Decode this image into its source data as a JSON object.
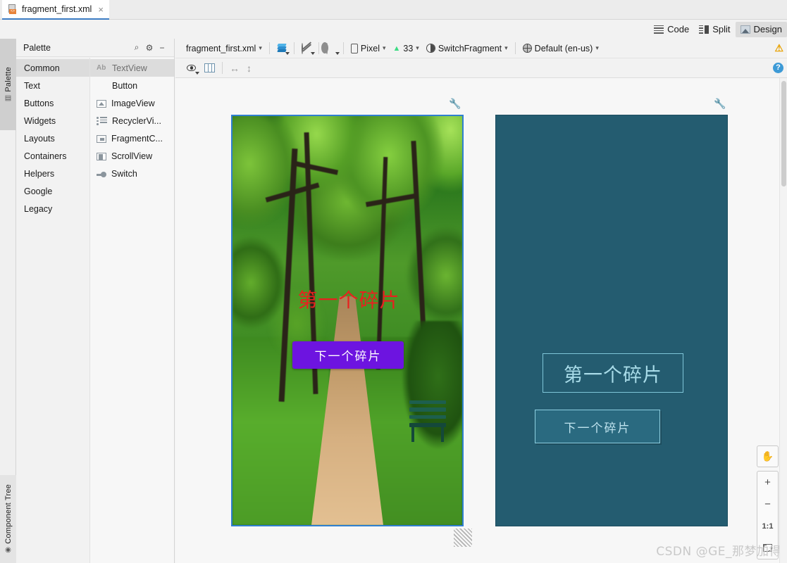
{
  "window": {
    "tab": {
      "title": "fragment_first.xml",
      "close": "×",
      "icon": "xml-layout-file-icon"
    }
  },
  "mode_bar": {
    "items": [
      {
        "label": "Code",
        "icon": "code-lines-icon",
        "active": false
      },
      {
        "label": "Split",
        "icon": "split-view-icon",
        "active": false
      },
      {
        "label": "Design",
        "icon": "design-view-icon",
        "active": true
      }
    ]
  },
  "left_strip": {
    "tabs": [
      {
        "label": "Palette",
        "icon": "palette-icon"
      },
      {
        "label": "Component Tree",
        "icon": "component-tree-icon"
      }
    ]
  },
  "palette": {
    "title": "Palette",
    "actions": [
      {
        "name": "search-icon",
        "glyph": "⌕"
      },
      {
        "name": "gear-icon",
        "glyph": "⚙"
      },
      {
        "name": "minimize-icon",
        "glyph": "−"
      }
    ],
    "categories": [
      {
        "label": "Common",
        "selected": true
      },
      {
        "label": "Text",
        "selected": false
      },
      {
        "label": "Buttons",
        "selected": false
      },
      {
        "label": "Widgets",
        "selected": false
      },
      {
        "label": "Layouts",
        "selected": false
      },
      {
        "label": "Containers",
        "selected": false
      },
      {
        "label": "Helpers",
        "selected": false
      },
      {
        "label": "Google",
        "selected": false
      },
      {
        "label": "Legacy",
        "selected": false
      }
    ],
    "items": [
      {
        "label": "TextView",
        "icon": "textview-icon",
        "selected": true
      },
      {
        "label": "Button",
        "icon": "button-icon",
        "selected": false
      },
      {
        "label": "ImageView",
        "icon": "imageview-icon",
        "selected": false
      },
      {
        "label": "RecyclerVi...",
        "icon": "recyclerview-icon",
        "selected": false
      },
      {
        "label": "FragmentC...",
        "icon": "fragmentcontainer-icon",
        "selected": false
      },
      {
        "label": "ScrollView",
        "icon": "scrollview-icon",
        "selected": false
      },
      {
        "label": "Switch",
        "icon": "switch-icon",
        "selected": false
      }
    ]
  },
  "toolbar": {
    "file_label": "fragment_first.xml",
    "design_mode_icon": "layers-icon",
    "blueprint_toggle_icon": "no-constraints-icon",
    "theme_render_icon": "render-mode-icon",
    "device_label": "Pixel",
    "device_icon": "phone-icon",
    "api_label": "33",
    "api_icon": "android-icon",
    "theme_label": "SwitchFragment",
    "theme_icon": "theme-icon",
    "locale_label": "Default (en-us)",
    "locale_icon": "globe-icon",
    "warning_icon": "warning-icon",
    "warning_glyph": "⚠"
  },
  "view_toolbar": {
    "eye_icon": "visibility-icon",
    "columns_icon": "layout-columns-icon",
    "align_h_icon": "horizontal-arrow-icon",
    "align_h_glyph": "↔",
    "align_v_icon": "vertical-arrow-icon",
    "align_v_glyph": "↕",
    "help_icon": "help-icon",
    "help_glyph": "?"
  },
  "design_surface": {
    "wrench_icon": "wrench-icon",
    "previews": [
      {
        "name": "design-preview",
        "type": "render"
      },
      {
        "name": "blueprint-preview",
        "type": "blueprint"
      }
    ],
    "widgets": {
      "textview_text": "第一个碎片",
      "button_text": "下一个碎片",
      "textview_color": "#e8201f",
      "button_bg": "#6d14e0",
      "button_text_color": "#ffffff",
      "blueprint_bg": "#245c70",
      "blueprint_stroke": "#8ecfe0"
    }
  },
  "zoom_controls": {
    "pan": {
      "label": "✋",
      "name": "pan-hand-button"
    },
    "zoom_in": {
      "label": "+",
      "name": "zoom-in-button"
    },
    "zoom_out": {
      "label": "−",
      "name": "zoom-out-button"
    },
    "actual_size": {
      "label": "1:1",
      "name": "zoom-actual-size-button"
    },
    "fit": {
      "label": "",
      "name": "zoom-fit-button"
    }
  },
  "watermark": {
    "text": "CSDN @GЕ_那梦加得"
  }
}
